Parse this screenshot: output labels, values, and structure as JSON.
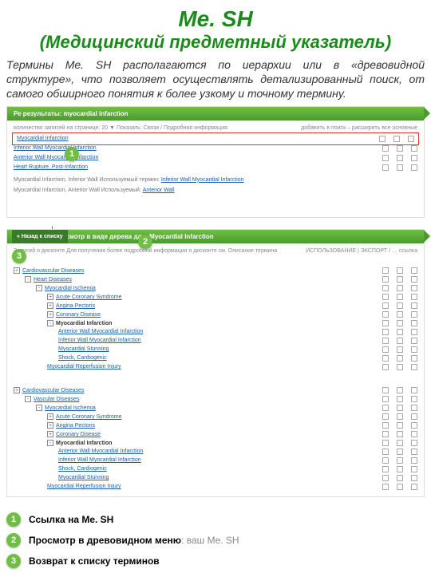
{
  "title_line1": "Me. SH",
  "title_line2": "(Медицинский предметный указатель)",
  "intro": "Термины Me. SH располагаются по иерархии или в «древовидной структуре», что позволяет осуществлять детализированный поиск, от самого обширного понятия к более узкому и точному термину.",
  "card1": {
    "bar": "Ре результаты: myocardial infarction",
    "meta_left": "количество записей на странице: 20 ▼   Показать: Связи / Подробная информация",
    "meta_right": "добавить в поиск – расширить   все   основные",
    "terms": [
      "Myocardial Infarction",
      "Inferior Wall Myocardial Infarction",
      "Anterior Wall Myocardial Infarction",
      "Heart Rupture, Post-Infarction"
    ],
    "note_prefix": "Myocardial Infarction, Inferior Wall   Используемый термин: ",
    "note_link1": "Inferior Wall Myocardial Infarction",
    "note_prefix2": "Myocardial Infarction, Anterior Wall   Используемый:",
    "note_link2": "Anterior Wall"
  },
  "card2": {
    "back": "« Назад к списку",
    "bar": "Просмотр в виде дерева для: Myocardial Infarction",
    "meta_left": "Записей о дисконте     Для получения более подробной информации о дисконте см.     Описание термина",
    "meta_right": "ИСПОЛЬЗОВАНИЕ | ЭКСПОРТ / … ссылка",
    "tree1": [
      {
        "d": 0,
        "p": "+",
        "t": "Cardiovascular Diseases"
      },
      {
        "d": 1,
        "p": "-",
        "t": "Heart Diseases"
      },
      {
        "d": 2,
        "p": "-",
        "t": "Myocardial Ischemia"
      },
      {
        "d": 3,
        "p": "+",
        "t": "Acute Coronary Syndrome"
      },
      {
        "d": 3,
        "p": "+",
        "t": "Angina Pectoris"
      },
      {
        "d": 3,
        "p": "+",
        "t": "Coronary Disease"
      },
      {
        "d": 3,
        "p": "-",
        "t": "Myocardial Infarction",
        "cur": true
      },
      {
        "d": 4,
        "p": "",
        "t": "Anterior Wall Myocardial Infarction"
      },
      {
        "d": 4,
        "p": "",
        "t": "Inferior Wall Myocardial Infarction"
      },
      {
        "d": 4,
        "p": "",
        "t": "Myocardial Stunning"
      },
      {
        "d": 4,
        "p": "",
        "t": "Shock, Cardiogenic"
      },
      {
        "d": 3,
        "p": "",
        "t": "Myocardial Reperfusion Injury"
      }
    ],
    "tree2": [
      {
        "d": 0,
        "p": "+",
        "t": "Cardiovascular Diseases"
      },
      {
        "d": 1,
        "p": "-",
        "t": "Vascular Diseases"
      },
      {
        "d": 2,
        "p": "-",
        "t": "Myocardial Ischemia"
      },
      {
        "d": 3,
        "p": "+",
        "t": "Acute Coronary Syndrome"
      },
      {
        "d": 3,
        "p": "+",
        "t": "Angina Pectoris"
      },
      {
        "d": 3,
        "p": "+",
        "t": "Coronary Disease"
      },
      {
        "d": 3,
        "p": "-",
        "t": "Myocardial Infarction",
        "cur": true
      },
      {
        "d": 4,
        "p": "",
        "t": "Anterior Wall Myocardial Infarction"
      },
      {
        "d": 4,
        "p": "",
        "t": "Inferior Wall Myocardial Infarction"
      },
      {
        "d": 4,
        "p": "",
        "t": "Shock, Cardiogenic"
      },
      {
        "d": 4,
        "p": "",
        "t": "Myocardial Stunning"
      },
      {
        "d": 3,
        "p": "",
        "t": "Myocardial Reperfusion Injury"
      }
    ]
  },
  "markers": {
    "m1": "1",
    "m2": "2",
    "m3": "3"
  },
  "legend": [
    {
      "n": "1",
      "bold": "Ссылка на Me. SH",
      "sub": ""
    },
    {
      "n": "2",
      "bold": "Просмотр в древовидном меню",
      "sub": ": ваш Me. SH"
    },
    {
      "n": "3",
      "bold": "Возврат к списку терминов",
      "sub": ""
    }
  ]
}
